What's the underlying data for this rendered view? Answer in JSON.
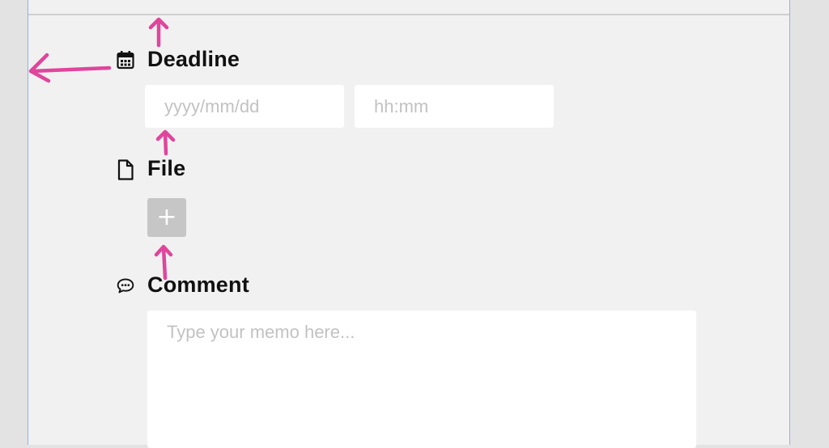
{
  "deadline": {
    "label": "Deadline",
    "icon": "calendar-icon",
    "date_placeholder": "yyyy/mm/dd",
    "time_placeholder": "hh:mm"
  },
  "file": {
    "label": "File",
    "icon": "file-icon",
    "add_button_label": "+"
  },
  "comment": {
    "label": "Comment",
    "icon": "speech-bubble-icon",
    "placeholder": "Type your memo here..."
  },
  "annotations": {
    "arrow_color": "#e0459c",
    "arrows": [
      "arrow-up-icon",
      "arrow-left-icon",
      "arrow-up-icon",
      "arrow-up-icon"
    ]
  }
}
